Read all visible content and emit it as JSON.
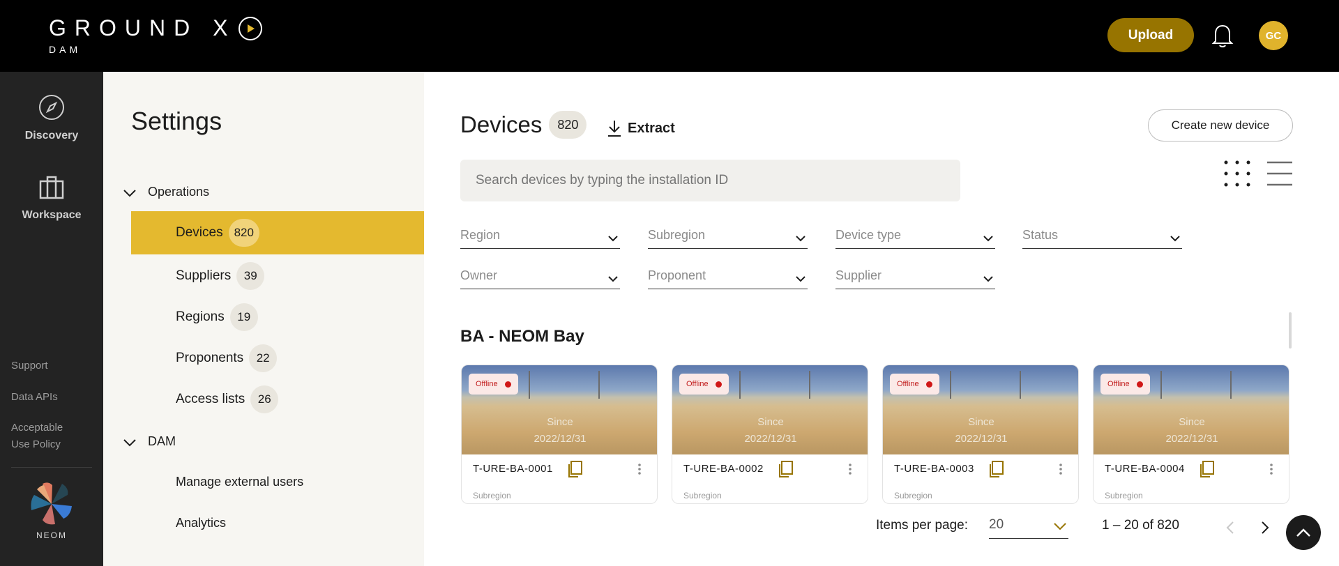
{
  "brand": {
    "name": "GROUND X",
    "sub": "DAM"
  },
  "header": {
    "upload_label": "Upload",
    "avatar_initials": "GC"
  },
  "leftnav": {
    "items": [
      {
        "label": "Discovery",
        "icon": "compass-icon"
      },
      {
        "label": "Workspace",
        "icon": "briefcase-icon"
      }
    ],
    "footer_links": [
      "Support",
      "Data APIs",
      "Acceptable",
      "Use Policy"
    ],
    "org": "NEOM"
  },
  "settings": {
    "title": "Settings",
    "groups": [
      {
        "label": "Operations",
        "items": [
          {
            "label": "Devices",
            "count": "820"
          },
          {
            "label": "Suppliers",
            "count": "39"
          },
          {
            "label": "Regions",
            "count": "19"
          },
          {
            "label": "Proponents",
            "count": "22"
          },
          {
            "label": "Access lists",
            "count": "26"
          }
        ]
      },
      {
        "label": "DAM",
        "items": [
          {
            "label": "Manage external users"
          },
          {
            "label": "Analytics"
          }
        ]
      }
    ]
  },
  "main": {
    "title": "Devices",
    "count": "820",
    "extract_label": "Extract",
    "create_label": "Create new device",
    "search_placeholder": "Search devices by typing the installation ID",
    "filters": [
      "Region",
      "Subregion",
      "Device type",
      "Status",
      "Owner",
      "Proponent",
      "Supplier"
    ],
    "section_title": "BA - NEOM Bay",
    "cards": [
      {
        "status": "Offline",
        "since_label": "Since",
        "since_date": "2022/12/31",
        "id": "T-URE-BA-0001",
        "subregion_label": "Subregion"
      },
      {
        "status": "Offline",
        "since_label": "Since",
        "since_date": "2022/12/31",
        "id": "T-URE-BA-0002",
        "subregion_label": "Subregion"
      },
      {
        "status": "Offline",
        "since_label": "Since",
        "since_date": "2022/12/31",
        "id": "T-URE-BA-0003",
        "subregion_label": "Subregion"
      },
      {
        "status": "Offline",
        "since_label": "Since",
        "since_date": "2022/12/31",
        "id": "T-URE-BA-0004",
        "subregion_label": "Subregion"
      }
    ],
    "pagination": {
      "items_per_page_label": "Items per page:",
      "items_per_page": "20",
      "range": "1 – 20 of 820"
    }
  },
  "colors": {
    "accent": "#e4b92f",
    "upload": "#977400",
    "offline": "#d01818"
  }
}
